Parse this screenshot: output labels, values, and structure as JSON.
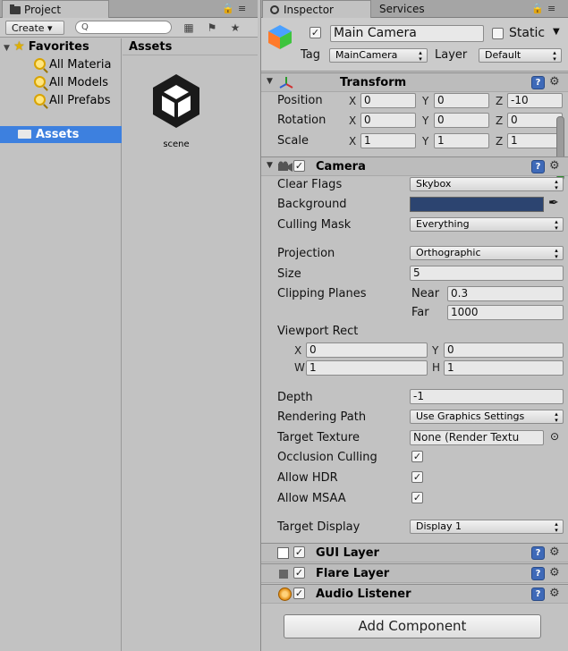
{
  "project": {
    "tab_label": "Project",
    "toolbar": {
      "create_label": "Create ▾",
      "search_placeholder": "Q"
    },
    "tree": {
      "favorites_label": "Favorites",
      "items": [
        "All Materia",
        "All Models",
        "All Prefabs"
      ],
      "assets_label": "Assets"
    },
    "assets_pane": {
      "header": "Assets",
      "items": [
        {
          "name": "scene",
          "icon": "unity-logo-icon"
        }
      ]
    }
  },
  "inspector": {
    "tabs": [
      "Inspector",
      "Services"
    ],
    "gameobject": {
      "name": "Main Camera",
      "active": true,
      "static_label": "Static",
      "tag_label": "Tag",
      "tag_value": "MainCamera",
      "layer_label": "Layer",
      "layer_value": "Default"
    },
    "transform": {
      "title": "Transform",
      "position_label": "Position",
      "position": {
        "x": "0",
        "y": "0",
        "z": "-10"
      },
      "rotation_label": "Rotation",
      "rotation": {
        "x": "0",
        "y": "0",
        "z": "0"
      },
      "scale_label": "Scale",
      "scale": {
        "x": "1",
        "y": "1",
        "z": "1"
      }
    },
    "camera": {
      "title": "Camera",
      "enabled": true,
      "clear_flags_label": "Clear Flags",
      "clear_flags": "Skybox",
      "background_label": "Background",
      "background_color": "#2c4470",
      "culling_mask_label": "Culling Mask",
      "culling_mask": "Everything",
      "projection_label": "Projection",
      "projection": "Orthographic",
      "size_label": "Size",
      "size": "5",
      "clipping_label": "Clipping Planes",
      "near_label": "Near",
      "near": "0.3",
      "far_label": "Far",
      "far": "1000",
      "viewport_label": "Viewport Rect",
      "viewport": {
        "x": "0",
        "y": "0",
        "w": "1",
        "h": "1"
      },
      "depth_label": "Depth",
      "depth": "-1",
      "rendering_path_label": "Rendering Path",
      "rendering_path": "Use Graphics Settings",
      "target_texture_label": "Target Texture",
      "target_texture": "None (Render Textu",
      "occlusion_label": "Occlusion Culling",
      "occlusion": true,
      "hdr_label": "Allow HDR",
      "hdr": true,
      "msaa_label": "Allow MSAA",
      "msaa": true,
      "target_display_label": "Target Display",
      "target_display": "Display 1"
    },
    "components": [
      {
        "title": "GUI Layer",
        "enabled": true
      },
      {
        "title": "Flare Layer",
        "enabled": true
      },
      {
        "title": "Audio Listener",
        "enabled": true
      }
    ],
    "add_component_label": "Add Component"
  },
  "axis_labels": {
    "x": "X",
    "y": "Y",
    "z": "Z",
    "w": "W",
    "h": "H"
  },
  "glyphs": {
    "check": "✓",
    "lock": "🔒",
    "menu": "≡",
    "foldout_open": "▼",
    "foldout_closed": "▶",
    "gear": "⚙",
    "help": "?",
    "dropdown": "▾",
    "target": "⊙",
    "pipette": "✒"
  },
  "colors": {
    "selection": "#3d80df",
    "help_icon": "#3f6ab8"
  }
}
